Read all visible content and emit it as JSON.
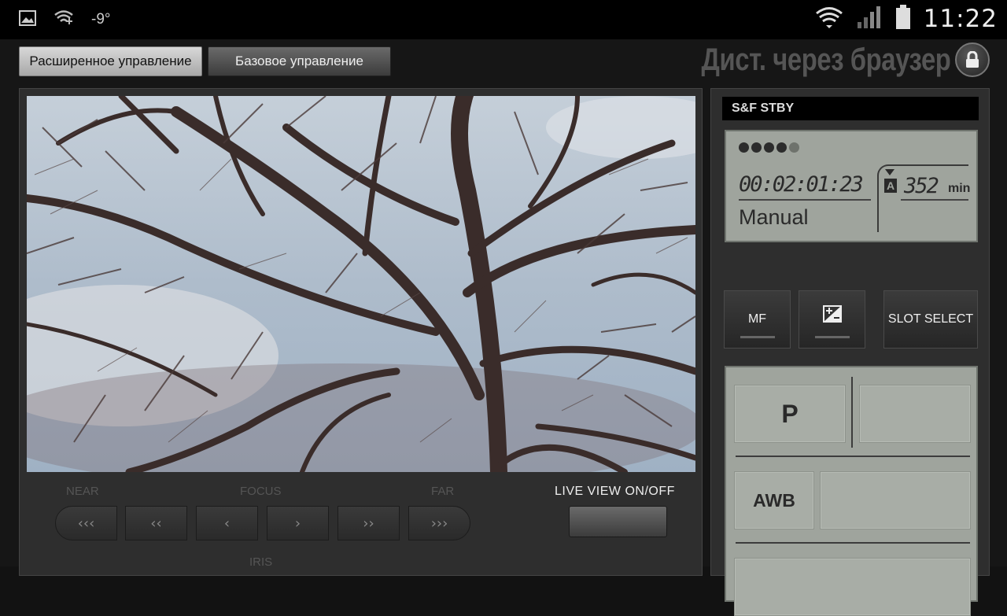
{
  "status_bar": {
    "temperature": "-9°",
    "time": "11:22"
  },
  "header": {
    "tab_advanced": "Расширенное управление",
    "tab_basic": "Базовое управление",
    "title": "Дист. через браузер"
  },
  "focus_controls": {
    "near_label": "NEAR",
    "focus_label": "FOCUS",
    "far_label": "FAR",
    "iris_label": "IRIS",
    "buttons": [
      "‹‹‹",
      "‹‹",
      "‹",
      "›",
      "››",
      "›››"
    ]
  },
  "live_view": {
    "label": "LIVE  VIEW  ON/OFF"
  },
  "camera_status": {
    "mode_bar": "S&F  STBY",
    "battery_dots_full": 4,
    "battery_dots_total": 5,
    "timecode": "00:02:01:23",
    "media_slot": "A",
    "remaining": "352",
    "remaining_unit": "min",
    "shooting_mode": "Manual"
  },
  "control_buttons": {
    "mf": "MF",
    "exposure_icon": "exposure-compensation-icon",
    "slot_select": "SLOT SELECT"
  },
  "settings": {
    "program": "P",
    "white_balance": "AWB"
  },
  "colors": {
    "lcd_background": "#9fa49d",
    "active_tab": "#c8c8c8"
  }
}
